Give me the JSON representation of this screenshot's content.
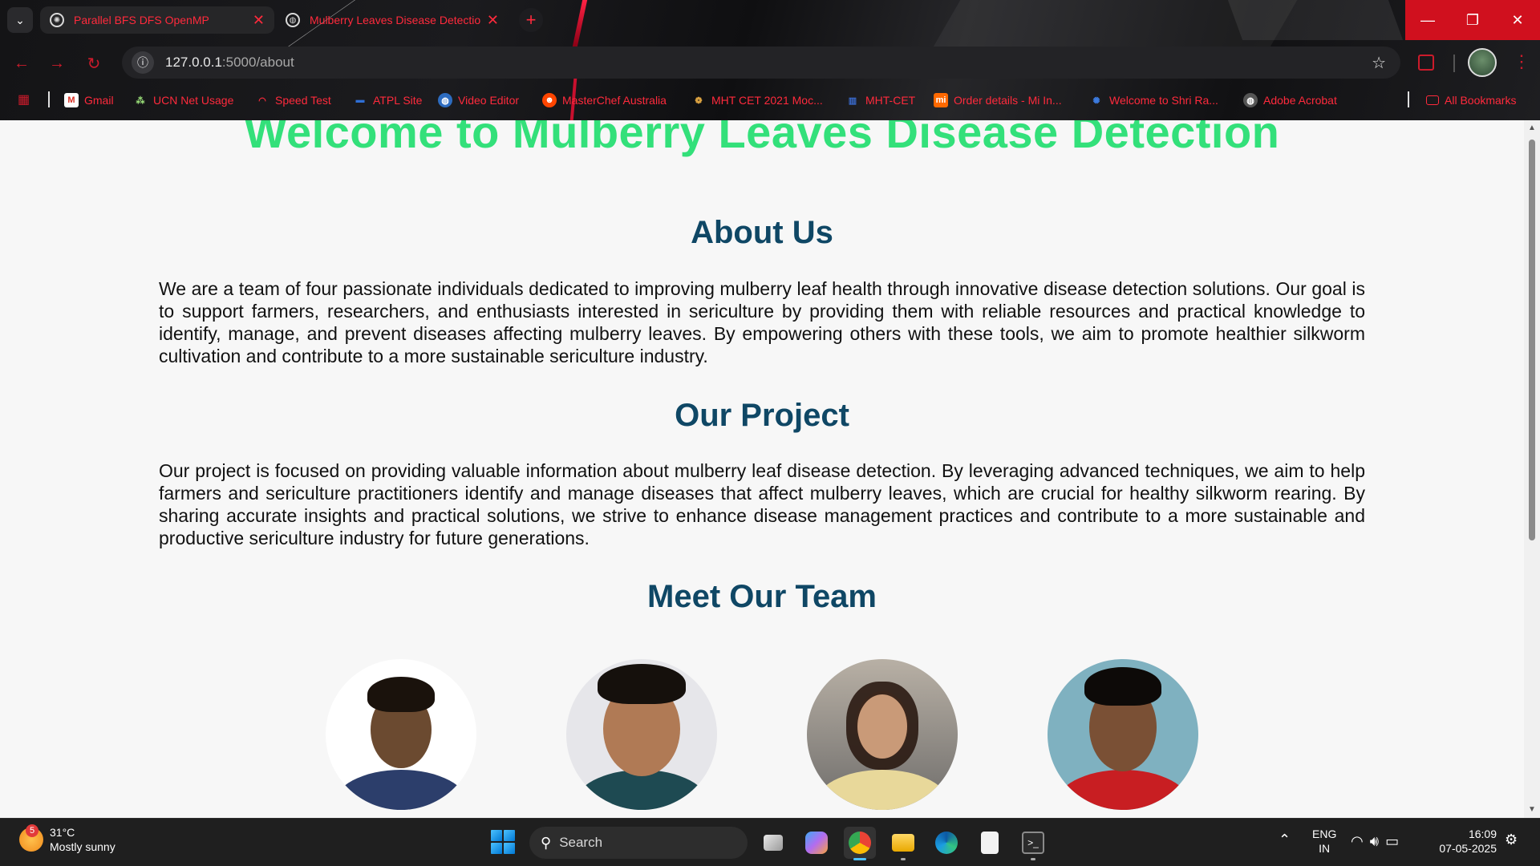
{
  "browser": {
    "tabs": [
      {
        "title": "Parallel BFS DFS OpenMP",
        "active": true
      },
      {
        "title": "Mulberry Leaves Disease Detection",
        "active": false
      }
    ],
    "url_host": "127.0.0.1",
    "url_rest": ":5000/about",
    "bookmarks": [
      {
        "label": "Gmail",
        "icon": "gmail-icon"
      },
      {
        "label": "UCN Net Usage",
        "icon": "ucn-icon"
      },
      {
        "label": "Speed Test",
        "icon": "speedometer-icon"
      },
      {
        "label": "ATPL Site",
        "icon": "atpl-icon"
      },
      {
        "label": "Video Editor",
        "icon": "globe-icon"
      },
      {
        "label": "MasterChef Australia",
        "icon": "reddit-icon"
      },
      {
        "label": "MHT CET 2021 Moc...",
        "icon": "globe-icon"
      },
      {
        "label": "MHT-CET",
        "icon": "mhtcet-icon"
      },
      {
        "label": "Order details - Mi In...",
        "icon": "mi-icon"
      },
      {
        "label": "Welcome to Shri Ra...",
        "icon": "shri-icon"
      },
      {
        "label": "Adobe Acrobat",
        "icon": "globe-icon"
      }
    ],
    "all_bookmarks": "All Bookmarks"
  },
  "page": {
    "hero_title": "Welcome to Mulberry Leaves Disease Detection",
    "about_heading": "About Us",
    "about_text": "We are a team of four passionate individuals dedicated to improving mulberry leaf health through innovative disease detection solutions. Our goal is to support farmers, researchers, and enthusiasts interested in sericulture by providing them with reliable resources and practical knowledge to identify, manage, and prevent diseases affecting mulberry leaves. By empowering others with these tools, we aim to promote healthier silkworm cultivation and contribute to a more sustainable sericulture industry.",
    "project_heading": "Our Project",
    "project_text": "Our project is focused on providing valuable information about mulberry leaf disease detection. By leveraging advanced techniques, we aim to help farmers and sericulture practitioners identify and manage diseases that affect mulberry leaves, which are crucial for healthy silkworm rearing. By sharing accurate insights and practical solutions, we strive to enhance disease management practices and contribute to a more sustainable and productive sericulture industry for future generations.",
    "team_heading": "Meet Our Team"
  },
  "taskbar": {
    "weather_badge": "5",
    "temperature": "31°C",
    "condition": "Mostly sunny",
    "search_placeholder": "Search",
    "lang_top": "ENG",
    "lang_bottom": "IN",
    "time": "16:09",
    "date": "07-05-2025"
  },
  "colors": {
    "hero": "#33e07a",
    "heading": "#0f4765",
    "chrome_accent": "#ff2a3c"
  }
}
